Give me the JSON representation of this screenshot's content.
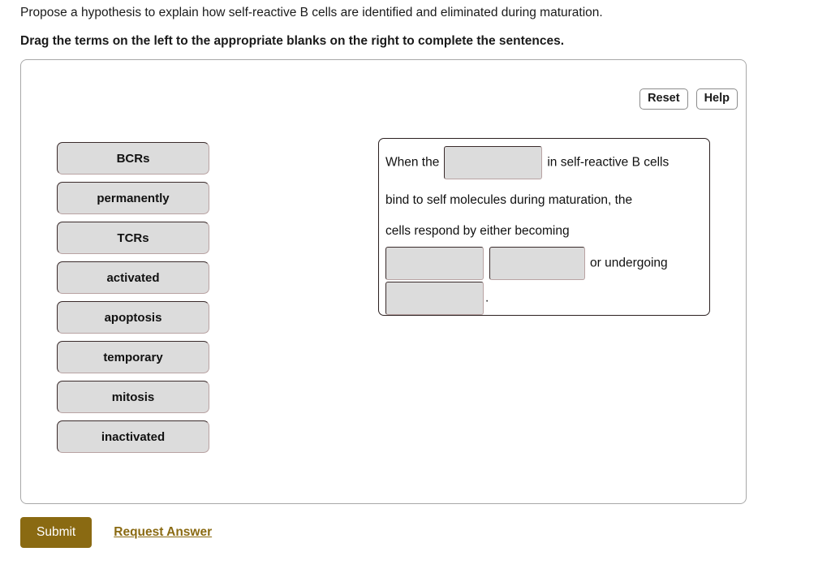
{
  "prompt": {
    "question": "Propose a hypothesis to explain how self-reactive B cells are identified and eliminated during maturation.",
    "instruction": "Drag the terms on the left to the appropriate blanks on the right to complete the sentences."
  },
  "toolbar": {
    "reset_label": "Reset",
    "help_label": "Help"
  },
  "term_bank": {
    "terms": [
      {
        "label": "BCRs"
      },
      {
        "label": "permanently"
      },
      {
        "label": "TCRs"
      },
      {
        "label": "activated"
      },
      {
        "label": "apoptosis"
      },
      {
        "label": "temporary"
      },
      {
        "label": "mitosis"
      },
      {
        "label": "inactivated"
      }
    ]
  },
  "sentence": {
    "segments": {
      "s1": "When the",
      "s2": "in self-reactive B cells",
      "s3": "bind to self molecules during maturation, the",
      "s4": "cells respond by either becoming",
      "s5": "or undergoing",
      "s6": "."
    },
    "blanks": [
      {
        "value": ""
      },
      {
        "value": ""
      },
      {
        "value": ""
      },
      {
        "value": ""
      }
    ]
  },
  "footer": {
    "submit_label": "Submit",
    "request_answer_label": "Request Answer"
  },
  "colors": {
    "accent_brown": "#8a6a12",
    "tile_fill": "#dcdcdc",
    "tile_border_dark": "#3a2b2b",
    "tile_border_light": "#b9a3a3",
    "panel_border": "#a8a8a8",
    "sentence_border": "#2b2020"
  }
}
